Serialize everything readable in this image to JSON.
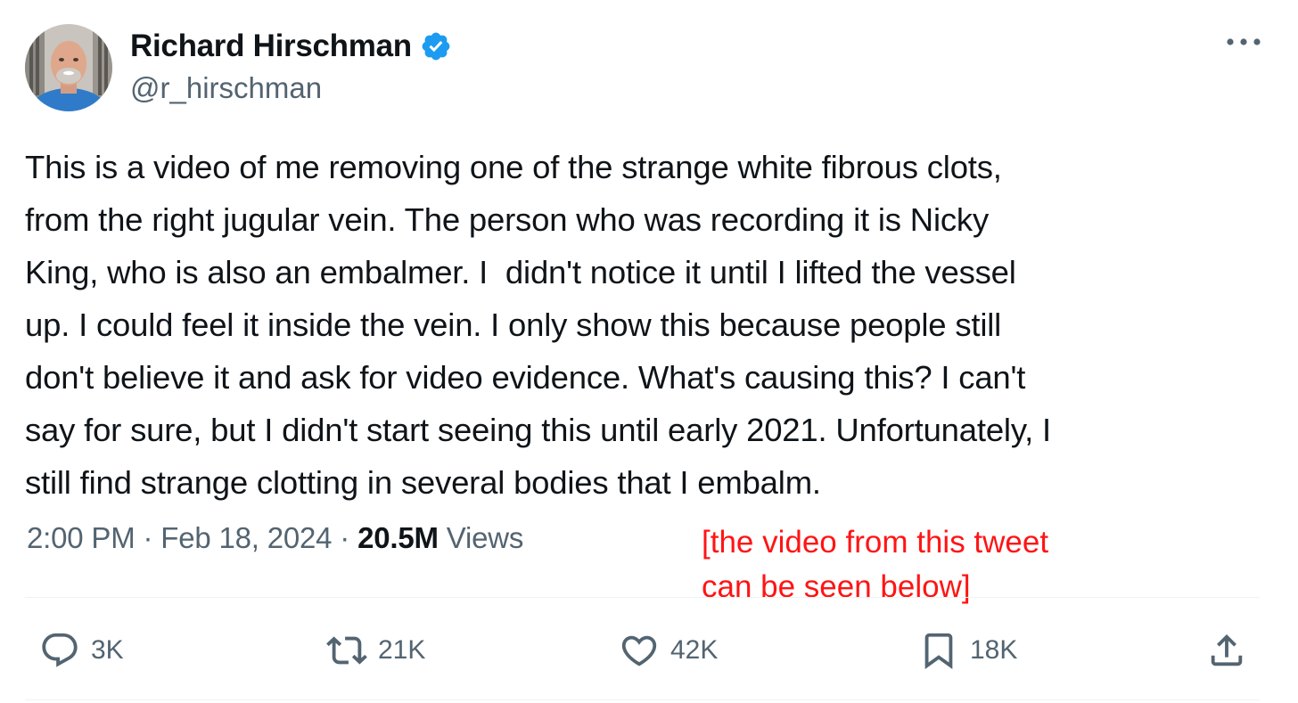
{
  "author": {
    "display_name": "Richard Hirschman",
    "handle": "@r_hirschman",
    "verified": true,
    "verified_color": "#1d9bf0"
  },
  "tweet": {
    "text": "This is a video of me removing one of the strange white fibrous clots,\nfrom the right jugular vein. The person who was recording it is Nicky\nKing, who is also an embalmer. I  didn't notice it until I lifted the vessel\nup. I could feel it inside the vein. I only show this because people still\ndon't believe it and ask for video evidence. What's causing this? I can't\nsay for sure, but I didn't start seeing this until early 2021. Unfortunately, I\nstill find strange clotting in several bodies that I embalm.",
    "time": "2:00 PM",
    "separator": "·",
    "date": "Feb 18, 2024",
    "views_count": "20.5M",
    "views_label": "Views"
  },
  "annotation": {
    "line1": "[the video from this tweet",
    "line2": "can be seen below]",
    "color": "#ff1414"
  },
  "actions": {
    "reply": {
      "icon": "reply-icon",
      "count": "3K"
    },
    "retweet": {
      "icon": "retweet-icon",
      "count": "21K"
    },
    "like": {
      "icon": "heart-icon",
      "count": "42K"
    },
    "bookmark": {
      "icon": "bookmark-icon",
      "count": "18K"
    },
    "share": {
      "icon": "share-icon"
    }
  },
  "colors": {
    "text_primary": "#0f1419",
    "text_secondary": "#536471",
    "divider": "#eff3f4"
  }
}
